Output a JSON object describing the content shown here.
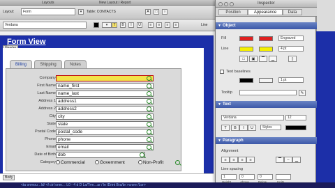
{
  "app": {
    "menu_left": "Layouts",
    "menu_center": "New Layout / Report"
  },
  "toolbar": {
    "layout_label": "Layout:",
    "layout_value": "Form",
    "table_label": "Table: CONTACTS",
    "font_value": "Verdana",
    "line_label": "Line",
    "accent_color": "#1c2fa8"
  },
  "layout": {
    "header_title": "Form View",
    "header_part_label": "Header",
    "body_part_label": "Body",
    "tabs": [
      {
        "label": "Billing",
        "active": true
      },
      {
        "label": "Shipping",
        "active": false
      },
      {
        "label": "Notes",
        "active": false
      }
    ],
    "fields": [
      {
        "label": "Company",
        "value": ""
      },
      {
        "label": "First Name",
        "value": "name_first"
      },
      {
        "label": "Last Name",
        "value": "name_last"
      },
      {
        "label": "Address 1",
        "value": "address1"
      },
      {
        "label": "Address 2",
        "value": "address2"
      },
      {
        "label": "City",
        "value": "city"
      },
      {
        "label": "State",
        "value": "state"
      },
      {
        "label": "Postal Code",
        "value": "postal_code"
      },
      {
        "label": "Phone",
        "value": "phone"
      },
      {
        "label": "Email",
        "value": "email"
      },
      {
        "label": "Date of Birth",
        "value": "dob"
      }
    ],
    "category": {
      "label": "Category",
      "options": [
        "Commercial",
        "Government",
        "Non-Profit"
      ]
    },
    "status_text": "<ta onmou…ld/ <f ctrl onm… L0 - 4 d D  La/Trm…ar / ln   IDrint Bra/br >crore /Lor>"
  },
  "inspector": {
    "title": "Inspector",
    "tabs": [
      {
        "label": "Position",
        "active": false
      },
      {
        "label": "Appearance",
        "active": true
      },
      {
        "label": "Data",
        "active": false
      }
    ],
    "object_section": "Object",
    "fill_label": "Fill",
    "line_label": "Line",
    "fill_style": "Engraved",
    "line_width": "4 pt",
    "text_baselines_label": "Text baselines",
    "baseline_width": "1 pt",
    "tooltip_label": "Tooltip",
    "text_section": "Text",
    "text_font": "Verdana",
    "text_size": "12",
    "text_style": "Styles",
    "bold": "B",
    "italic": "I",
    "underline": "U",
    "paragraph_section": "Paragraph",
    "alignment_label": "Alignment",
    "line_spacing_label": "Line spacing",
    "spacing_values": [
      "1",
      "0",
      "0"
    ],
    "spacing_headers": [
      "Height",
      "Above",
      "Below",
      "Units"
    ],
    "fill_color": "#e02020",
    "line_color": "#f5f000",
    "text_color": "#000000"
  }
}
